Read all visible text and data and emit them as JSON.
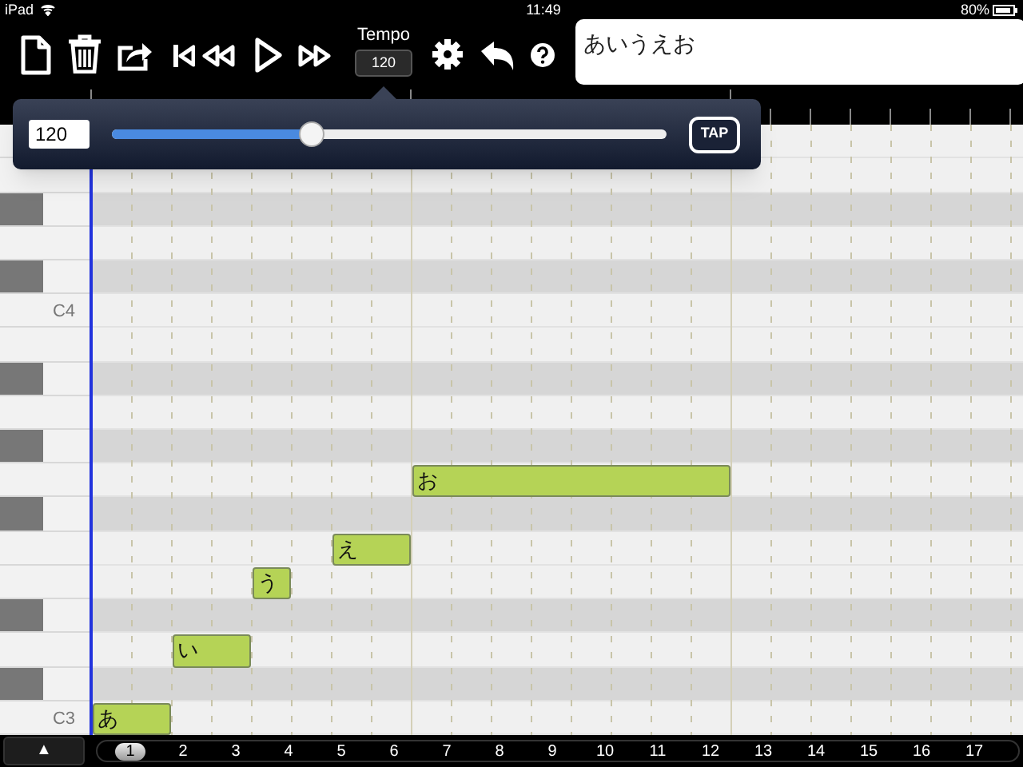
{
  "status_bar": {
    "device": "iPad",
    "time": "11:49",
    "battery": "80%"
  },
  "toolbar": {
    "tempo_label": "Tempo",
    "tempo_value": "120",
    "lyrics": "あいうえお"
  },
  "tempo_popup": {
    "value": "120",
    "level": 0.36,
    "tap": "TAP"
  },
  "keyboard": {
    "labels": [
      "C4",
      "C3"
    ]
  },
  "notes": [
    {
      "lyric": "あ"
    },
    {
      "lyric": "い"
    },
    {
      "lyric": "う"
    },
    {
      "lyric": "え"
    },
    {
      "lyric": "お"
    }
  ],
  "bottom_bar": {
    "toggle": "▲",
    "measures": [
      {
        "label": "1",
        "selected": true
      },
      {
        "label": "2",
        "selected": false
      },
      {
        "label": "3",
        "selected": false
      },
      {
        "label": "4",
        "selected": false
      },
      {
        "label": "5",
        "selected": false
      },
      {
        "label": "6",
        "selected": false
      },
      {
        "label": "7",
        "selected": false
      },
      {
        "label": "8",
        "selected": false
      },
      {
        "label": "9",
        "selected": false
      },
      {
        "label": "10",
        "selected": false
      },
      {
        "label": "11",
        "selected": false
      },
      {
        "label": "12",
        "selected": false
      },
      {
        "label": "13",
        "selected": false
      },
      {
        "label": "14",
        "selected": false
      },
      {
        "label": "15",
        "selected": false
      },
      {
        "label": "16",
        "selected": false
      },
      {
        "label": "17",
        "selected": false
      }
    ]
  }
}
